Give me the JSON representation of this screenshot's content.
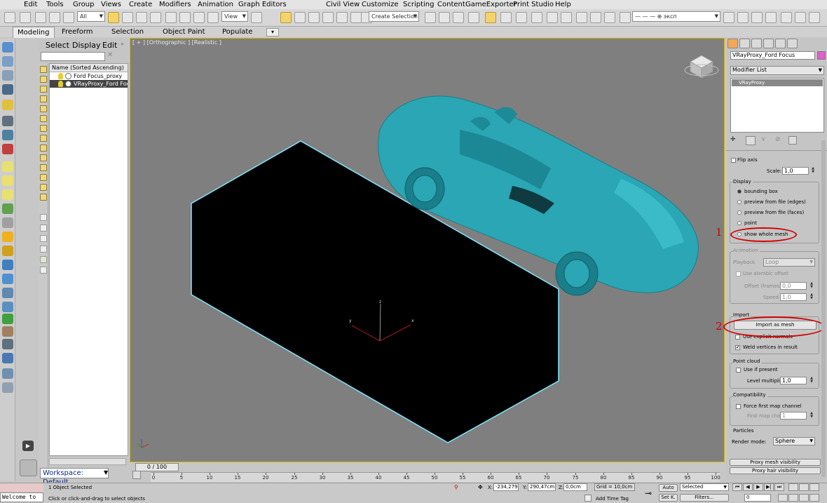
{
  "menu": [
    "Edit",
    "Tools",
    "Group",
    "Views",
    "Create",
    "Modifiers",
    "Animation",
    "Graph Editors",
    "Civil View",
    "Customize",
    "Scripting",
    "Content",
    "GameExporter",
    "Print Studio",
    "Help"
  ],
  "toolbar": {
    "filter_value": "All",
    "refcoord_value": "View",
    "selection_set_placeholder": "Create Selection Se",
    "layer_value": "— — — ⊕ эксп"
  },
  "ribbon": {
    "tabs": [
      "Modeling",
      "Freeform",
      "Selection",
      "Object Paint",
      "Populate"
    ],
    "active": "Modeling",
    "extra": "▾"
  },
  "explorer": {
    "tabs": [
      "Select",
      "Display",
      "Edit"
    ],
    "column_header": "Name (Sorted Ascending)",
    "items": [
      {
        "name": "Ford Focus_proxy",
        "selected": false
      },
      {
        "name": "VRayProxy_Ford Focus",
        "selected": true
      }
    ],
    "workspace": "Workspace: Default"
  },
  "viewport": {
    "label": "[ + ] [Orthographic ] [Realistic ]",
    "axis_z": "z",
    "axis_x": "x",
    "axis_y": "y"
  },
  "command_panel": {
    "object_name": "VRayProxy_Ford Focus",
    "object_color": "#e060d0",
    "modifier_list_label": "Modifier List",
    "stack_item": "VRayProxy",
    "flip_axis_label": "Flip axis",
    "scale_label": "Scale:",
    "scale_value": "1,0",
    "display_group": "Display",
    "display_options": [
      {
        "label": "bounding box",
        "checked": true
      },
      {
        "label": "preview from file (edges)",
        "checked": false
      },
      {
        "label": "preview from file (faces)",
        "checked": false
      },
      {
        "label": "point",
        "checked": false
      },
      {
        "label": "show whole mesh",
        "checked": false
      }
    ],
    "animation_group": "Animation",
    "playback_label": "Playback",
    "playback_value": "Loop",
    "alembic_label": "Use alembic offset",
    "offset_label": "Offset (frames)",
    "offset_value": "0,0",
    "speed_label": "Speed",
    "speed_value": "1,0",
    "import_group": "Import",
    "import_button": "Import as mesh",
    "explicit_normals": "Use explicit normals",
    "weld_label": "Weld vertices in result",
    "point_cloud_group": "Point cloud",
    "use_if_present": "Use if present",
    "level_multiplier_label": "Level multiplier",
    "level_multiplier_value": "1,0",
    "compat_group": "Compatibility",
    "force_first_map": "Force first map channel",
    "first_map_label": "First map chan",
    "first_map_value": "1",
    "particles_group": "Particles",
    "render_mode_label": "Render mode:",
    "render_mode_value": "Sphere",
    "rollout_1": "Proxy mesh visibility",
    "rollout_2": "Proxy hair visibility",
    "annotation_1": "1",
    "annotation_2": "2"
  },
  "timeline": {
    "slider": "0 / 100",
    "ticks": [
      "0",
      "5",
      "10",
      "15",
      "20",
      "25",
      "30",
      "35",
      "40",
      "45",
      "50",
      "55",
      "60",
      "65",
      "70",
      "75",
      "80",
      "85",
      "90",
      "95",
      "100"
    ]
  },
  "status": {
    "maxscript": "Welcome to",
    "selected": "1 Object Selected",
    "prompt": "Click or click-and-drag to select objects",
    "x_label": "X:",
    "x_value": "-234,279cı",
    "y_label": "Y:",
    "y_value": "290,47cm",
    "z_label": "Z:",
    "z_value": "0,0cm",
    "grid": "Grid = 10,0cm",
    "add_time_tag": "Add Time Tag",
    "auto": "Auto",
    "set_key": "Set K.",
    "key_mode": "Selected",
    "filters": "Filters...",
    "frame": "0"
  }
}
